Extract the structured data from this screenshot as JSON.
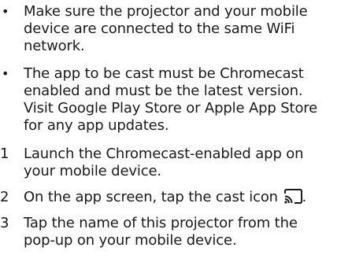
{
  "bullets": [
    {
      "marker": "•",
      "lines": [
        "Make sure the projector and your mobile",
        "device are connected to the same WiFi",
        "network."
      ]
    },
    {
      "marker": "•",
      "lines": [
        "The app to be cast must be Chromecast",
        "enabled and must be the latest version.",
        "Visit Google Play Store or Apple App Store",
        "for any app updates."
      ]
    }
  ],
  "steps": [
    {
      "number": "1",
      "lines": [
        "Launch the Chromecast-enabled app on",
        "your mobile device."
      ]
    },
    {
      "number": "2",
      "text_before_icon": "On the app screen, tap the cast icon",
      "icon": "cast-icon",
      "text_after_icon": "."
    },
    {
      "number": "3",
      "lines": [
        "Tap the name of this projector from the",
        "pop-up on your mobile device."
      ]
    }
  ]
}
